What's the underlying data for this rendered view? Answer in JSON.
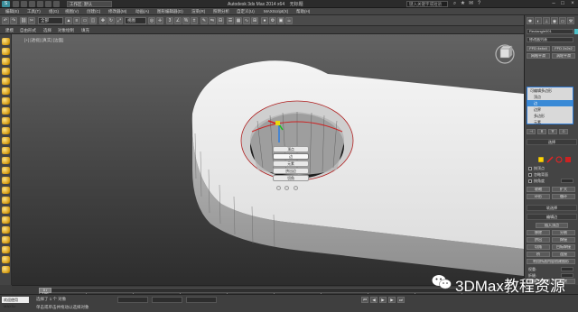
{
  "app": {
    "title": "Autodesk 3ds Max 2014 x64",
    "file": "无标题",
    "workspace": "工作区: 默认",
    "search_placeholder": "键入关键字或短语"
  },
  "menubar": {
    "items": [
      "编辑(E)",
      "工具(T)",
      "组(G)",
      "视图(V)",
      "创建(C)",
      "修改器(M)",
      "动画(A)",
      "图形编辑器(D)",
      "渲染(R)",
      "照明分析",
      "自定义(U)",
      "MAXScript(X)",
      "帮助(H)"
    ]
  },
  "toolbar": {
    "filter_value": "全部",
    "view_value": "视图"
  },
  "ribbon": {
    "tabs": [
      "建模",
      "自由形式",
      "选择",
      "对象绘制",
      "填充"
    ]
  },
  "viewport": {
    "label": "[+] [透视] [真实] [边面]",
    "quad_menu": {
      "items": [
        "顶点",
        "边",
        "元素",
        "挤出边",
        "切角"
      ],
      "active": "边"
    }
  },
  "command_panel": {
    "object_name": "Rectangle001",
    "modifier_list_label": "修改器列表",
    "buttons": [
      "FFD 4x4x4",
      "FFD 2x2x2",
      "网格平滑",
      "涡轮平滑"
    ],
    "stack": [
      {
        "label": "可编辑多边形",
        "level": 0,
        "selected": false
      },
      {
        "label": "顶点",
        "level": 1,
        "selected": false
      },
      {
        "label": "边",
        "level": 1,
        "selected": true
      },
      {
        "label": "边界",
        "level": 1,
        "selected": false
      },
      {
        "label": "多边形",
        "level": 1,
        "selected": false
      },
      {
        "label": "元素",
        "level": 1,
        "selected": false
      }
    ],
    "rollout_select": "选择",
    "check_by_vertex": "按顶点",
    "check_ignore_back": "忽略背面",
    "check_by_angle": "按角度",
    "angle_value": "45.0",
    "shrink_label": "收缩",
    "grow_label": "扩大",
    "ring_label": "环形",
    "loop_label": "循环",
    "rollout_soft": "软选择",
    "rollout_edit": "编辑边",
    "insert_vertex": "插入顶点",
    "remove_label": "移除",
    "split_label": "分割",
    "extrude_label": "挤出",
    "weld_label": "焊接",
    "chamfer_label": "切角",
    "target_weld": "目标焊接",
    "bridge_label": "桥",
    "connect_label": "连接",
    "create_shape": "利用所选内容创建图形",
    "weight_label": "权重:",
    "crease_label": "折缝:",
    "edit_tri": "编辑三角形",
    "rotate_label": "旋转"
  },
  "timeline": {
    "position": "0 / 100",
    "ticks": [
      "0",
      "10",
      "20",
      "30",
      "40",
      "50",
      "60",
      "70",
      "80",
      "90",
      "100"
    ]
  },
  "status": {
    "maxscript": "欢迎使用 MAXSc",
    "selection": "选择了 1 个 对象",
    "prompt": "单击或单击并拖动以选择对象"
  },
  "watermark": {
    "text": "3DMax教程资源"
  },
  "colors": {
    "accent": "#3a8ad6",
    "selection_red": "#cc2222",
    "swatch": "#4fc0c8"
  }
}
